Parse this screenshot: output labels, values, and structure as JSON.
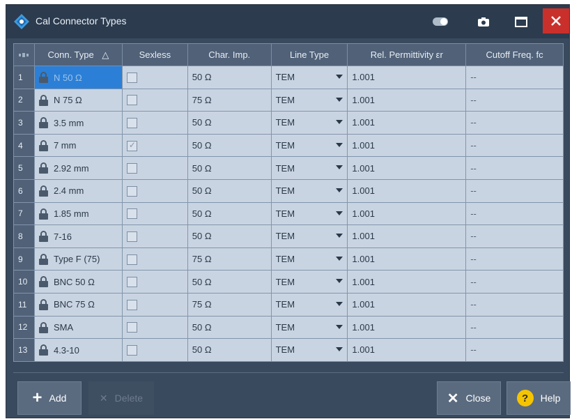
{
  "window": {
    "title": "Cal Connector Types",
    "close_glyph": "✕"
  },
  "table": {
    "columns": [
      "",
      "Conn. Type",
      "Sexless",
      "Char. Imp.",
      "Line Type",
      "Rel. Permittivity εr",
      "Cutoff Freq. fc"
    ],
    "sort_indicator": "△",
    "rows": [
      {
        "num": "1",
        "conn": "N 50 Ω",
        "sexless": false,
        "imp": "50 Ω",
        "line": "TEM",
        "perm": "1.001",
        "cutoff": "--",
        "selected": true
      },
      {
        "num": "2",
        "conn": "N 75 Ω",
        "sexless": false,
        "imp": "75 Ω",
        "line": "TEM",
        "perm": "1.001",
        "cutoff": "--"
      },
      {
        "num": "3",
        "conn": "3.5 mm",
        "sexless": false,
        "imp": "50 Ω",
        "line": "TEM",
        "perm": "1.001",
        "cutoff": "--"
      },
      {
        "num": "4",
        "conn": "7 mm",
        "sexless": true,
        "imp": "50 Ω",
        "line": "TEM",
        "perm": "1.001",
        "cutoff": "--"
      },
      {
        "num": "5",
        "conn": "2.92 mm",
        "sexless": false,
        "imp": "50 Ω",
        "line": "TEM",
        "perm": "1.001",
        "cutoff": "--"
      },
      {
        "num": "6",
        "conn": "2.4 mm",
        "sexless": false,
        "imp": "50 Ω",
        "line": "TEM",
        "perm": "1.001",
        "cutoff": "--"
      },
      {
        "num": "7",
        "conn": "1.85 mm",
        "sexless": false,
        "imp": "50 Ω",
        "line": "TEM",
        "perm": "1.001",
        "cutoff": "--"
      },
      {
        "num": "8",
        "conn": "7-16",
        "sexless": false,
        "imp": "50 Ω",
        "line": "TEM",
        "perm": "1.001",
        "cutoff": "--"
      },
      {
        "num": "9",
        "conn": "Type F (75)",
        "sexless": false,
        "imp": "75 Ω",
        "line": "TEM",
        "perm": "1.001",
        "cutoff": "--"
      },
      {
        "num": "10",
        "conn": "BNC 50 Ω",
        "sexless": false,
        "imp": "50 Ω",
        "line": "TEM",
        "perm": "1.001",
        "cutoff": "--"
      },
      {
        "num": "11",
        "conn": "BNC 75 Ω",
        "sexless": false,
        "imp": "75 Ω",
        "line": "TEM",
        "perm": "1.001",
        "cutoff": "--"
      },
      {
        "num": "12",
        "conn": "SMA",
        "sexless": false,
        "imp": "50 Ω",
        "line": "TEM",
        "perm": "1.001",
        "cutoff": "--"
      },
      {
        "num": "13",
        "conn": "4.3-10",
        "sexless": false,
        "imp": "50 Ω",
        "line": "TEM",
        "perm": "1.001",
        "cutoff": "--"
      }
    ]
  },
  "buttons": {
    "add": "Add",
    "delete": "Delete",
    "close": "Close",
    "help": "Help",
    "help_glyph": "?",
    "close_glyph": "✕",
    "add_glyph": "+"
  }
}
